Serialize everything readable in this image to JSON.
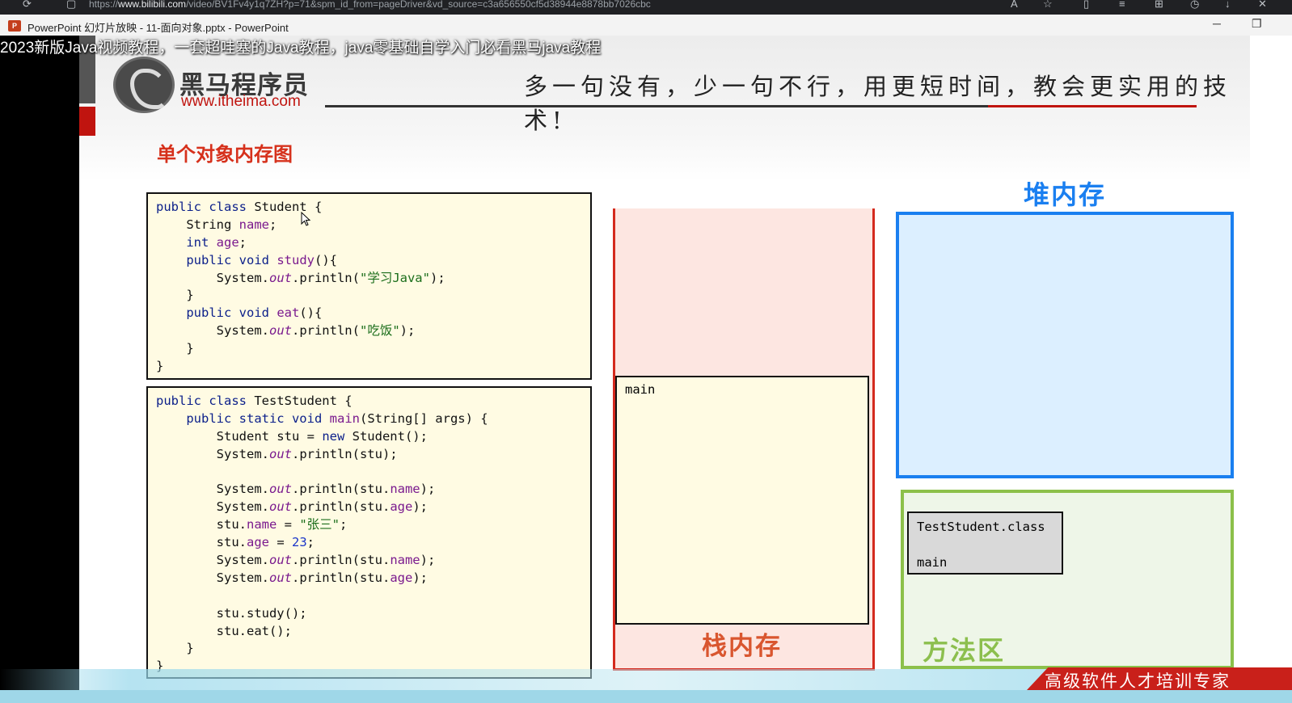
{
  "browser": {
    "url_prefix": "https://",
    "url_host": "www.bilibili.com",
    "url_rest": "/video/BV1Fv4y1q7ZH?p=71&spm_id_from=pageDriver&vd_source=c3a656550cf5d38944e8878bb7026cbc",
    "icons": [
      "refresh-icon",
      "lock-icon",
      "read-aloud-icon",
      "favorite-icon",
      "split-screen-icon",
      "favorites-list-icon",
      "collections-icon",
      "history-icon",
      "download-icon",
      "extensions-icon"
    ]
  },
  "ppt_window": {
    "title": "PowerPoint 幻灯片放映 - 11-面向对象.pptx - PowerPoint",
    "minimize": "─",
    "restore": "❐"
  },
  "video_title": "2023新版Java视频教程，一套超哇塞的Java教程，java零基础自学入门必看黑马java教程",
  "slide": {
    "brand_name": "黑马程序员",
    "brand_url": "www.itheima.com",
    "slogan": "多一句没有，少一句不行，用更短时间，教会更实用的技术!",
    "title": "单个对象内存图",
    "stack_label": "栈内存",
    "heap_label": "堆内存",
    "method_label": "方法区",
    "main_frame_label": "main",
    "class_box_lines": [
      "TestStudent.class",
      "",
      "main"
    ],
    "footer": "高级软件人才培训专家"
  },
  "code_student": [
    "public class Student {",
    "    String name;",
    "    int age;",
    "    public void study(){",
    "        System.out.println(\"学习Java\");",
    "    }",
    "    public void eat(){",
    "        System.out.println(\"吃饭\");",
    "    }",
    "}"
  ],
  "code_test": [
    "public class TestStudent {",
    "    public static void main(String[] args) {",
    "        Student stu = new Student();",
    "        System.out.println(stu);",
    "",
    "        System.out.println(stu.name);",
    "        System.out.println(stu.age);",
    "        stu.name = \"张三\";",
    "        stu.age = 23;",
    "        System.out.println(stu.name);",
    "        System.out.println(stu.age);",
    "",
    "        stu.study();",
    "        stu.eat();",
    "    }",
    "}"
  ],
  "colors": {
    "stack_border": "#d42a1e",
    "heap_border": "#1a7ff0",
    "method_border": "#8cc04a",
    "title_red": "#d6311c"
  }
}
